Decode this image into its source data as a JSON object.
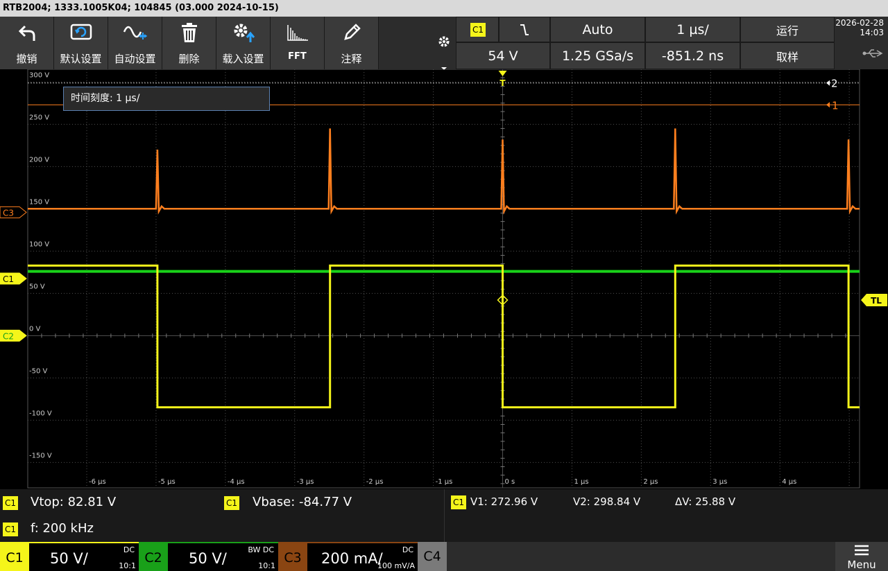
{
  "title": "RTB2004; 1333.1005K04; 104845 (03.000 2024-10-15)",
  "toolbar": {
    "undo": "撤销",
    "default_setup": "默认设置",
    "autoset": "自动设置",
    "delete": "删除",
    "load_setup": "载入设置",
    "fft": "FFT",
    "annotate": "注释"
  },
  "trigger": {
    "source": "C1",
    "slope_symbol": "⌄",
    "mode": "Auto",
    "level": "54 V",
    "timebase": "1 µs/",
    "sample_rate": "1.25 GSa/s",
    "position": "-851.2 ns",
    "run_state": "运行",
    "acq_mode": "取样"
  },
  "datetime": {
    "date": "2026-02-28",
    "time": "14:03"
  },
  "readout": {
    "label": "时间刻度: 1 µs/"
  },
  "grid": {
    "y_labels": [
      "300 V",
      "250 V",
      "200 V",
      "150 V",
      "100 V",
      "50 V",
      "0 V",
      "-50 V",
      "-100 V",
      "-150 V"
    ],
    "x_labels": [
      "-6 µs",
      "-5 µs",
      "-4 µs",
      "-3 µs",
      "-2 µs",
      "-1 µs",
      "0 s",
      "1 µs",
      "2 µs",
      "3 µs",
      "4 µs"
    ]
  },
  "markers": {
    "trigger_top": "T",
    "trigger_level": "TL",
    "cursor_1": "1",
    "cursor_2": "2",
    "ch3_offset": "C3",
    "ch1_offset": "C1",
    "ch2_offset": "C2"
  },
  "colors": {
    "ch1": "#f5f51a",
    "ch2": "#19d219",
    "ch3": "#ff7f1e",
    "grid": "#505050",
    "cursor": "#ff7f1e"
  },
  "measurements": {
    "vtop_badge": "C1",
    "vtop": "Vtop: 82.81 V",
    "vbase_badge": "C1",
    "vbase": "Vbase: -84.77 V",
    "freq_badge": "C1",
    "freq": "f: 200 kHz",
    "cursor_badge": "C1",
    "v1": "V1: 272.96 V",
    "v2": "V2: 298.84 V",
    "dv": "ΔV: 25.88 V"
  },
  "channels": [
    {
      "name": "C1",
      "scale": "50 V/",
      "coupling": "DC",
      "ratio": "10:1"
    },
    {
      "name": "C2",
      "scale": "50 V/",
      "coupling": "DC",
      "bw": "BW",
      "ratio": "10:1"
    },
    {
      "name": "C3",
      "scale": "200 mA/",
      "coupling": "DC",
      "ratio": "100 mV/A"
    },
    {
      "name": "C4"
    }
  ],
  "menu": "Menu",
  "chart_data": {
    "type": "line",
    "x_unit": "µs",
    "y_unit": "V",
    "xlim": [
      -6.851,
      5.149
    ],
    "ylim": [
      -180,
      315
    ],
    "series": [
      {
        "name": "C1",
        "description": "square wave",
        "points": [
          [
            -6.851,
            82.8
          ],
          [
            -4.98,
            82.8
          ],
          [
            -4.98,
            -84.8
          ],
          [
            -2.49,
            -84.8
          ],
          [
            -2.49,
            82.8
          ],
          [
            0.0,
            82.8
          ],
          [
            0.0,
            -84.8
          ],
          [
            2.49,
            -84.8
          ],
          [
            2.49,
            82.8
          ],
          [
            4.99,
            82.8
          ],
          [
            4.99,
            -84.8
          ],
          [
            5.149,
            -84.8
          ]
        ]
      },
      {
        "name": "C2",
        "description": "flat line",
        "points": [
          [
            -6.851,
            76
          ],
          [
            5.149,
            76
          ]
        ]
      },
      {
        "name": "C3",
        "description": "baseline with spikes at transitions",
        "baseline": 150,
        "spikes": [
          [
            -4.98,
            220
          ],
          [
            -2.49,
            245
          ],
          [
            0.0,
            232
          ],
          [
            2.49,
            245
          ],
          [
            4.99,
            232
          ]
        ]
      }
    ],
    "cursors": {
      "v1": 272.96,
      "v2": 298.84
    }
  }
}
